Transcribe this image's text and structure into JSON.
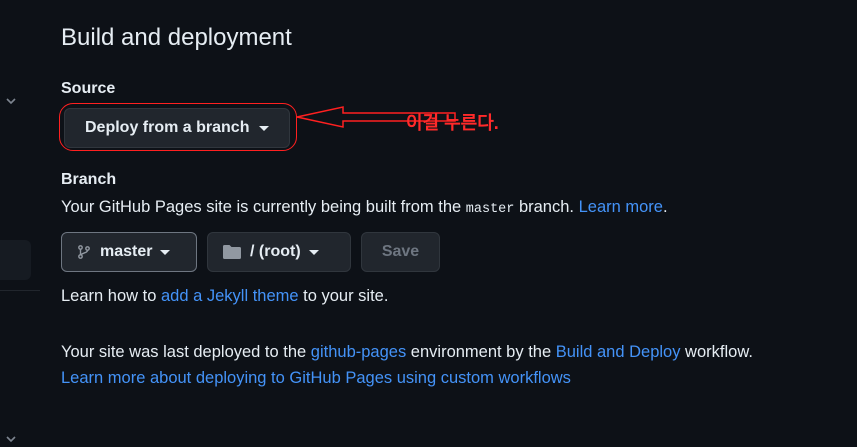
{
  "section_title": "Build and deployment",
  "source": {
    "label": "Source",
    "dropdown_value": "Deploy from a branch"
  },
  "annotation": {
    "text": "이걸 누른다.",
    "color": "#ff2020"
  },
  "branch": {
    "label": "Branch",
    "description_prefix": "Your GitHub Pages site is currently being built from the ",
    "branch_code": "master",
    "description_suffix": " branch. ",
    "learn_more": "Learn more",
    "period": ".",
    "branch_button": "master",
    "folder_button": "/ (root)",
    "save_button": "Save"
  },
  "jekyll": {
    "prefix": "Learn how to ",
    "link": "add a Jekyll theme",
    "suffix": " to your site."
  },
  "deploy_info": {
    "prefix": "Your site was last deployed to the ",
    "env_link": "github-pages",
    "middle": " environment by the ",
    "workflow_link": "Build and Deploy",
    "suffix": " workflow.",
    "custom_workflows_link": "Learn more about deploying to GitHub Pages using custom workflows"
  },
  "colors": {
    "background": "#0d1117",
    "link": "#4493f8",
    "button_bg": "#21262d"
  }
}
